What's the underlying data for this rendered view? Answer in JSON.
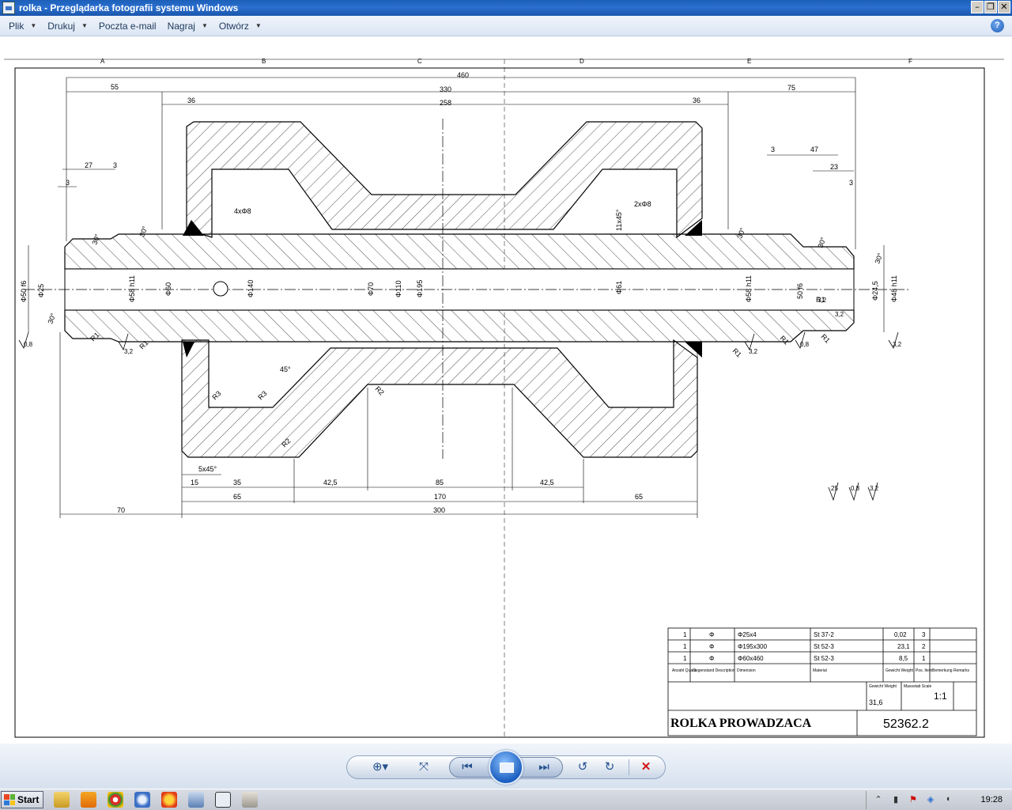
{
  "window": {
    "title": "rolka - Przeglądarka fotografii systemu Windows"
  },
  "menu": [
    {
      "label": "Plik"
    },
    {
      "label": "Drukuj"
    },
    {
      "label": "Poczta e-mail"
    },
    {
      "label": "Nagraj"
    },
    {
      "label": "Otwórz"
    }
  ],
  "drawing": {
    "zone_letters": [
      "A",
      "B",
      "C",
      "D",
      "E",
      "F"
    ],
    "dims_top": [
      "460",
      "55",
      "330",
      "75",
      "36",
      "258",
      "36",
      "27",
      "3",
      "3",
      "3",
      "47",
      "23",
      "3"
    ],
    "dims_bottom": [
      "5x45°",
      "15",
      "35",
      "42,5",
      "85",
      "42,5",
      "65",
      "170",
      "65",
      "70",
      "300"
    ],
    "diameters": [
      "Φ50 f6",
      "Φ25",
      "Φ58 h11",
      "Φ60",
      "Φ140",
      "Φ70",
      "Φ110",
      "Φ195",
      "Φ61",
      "Φ58 h11",
      "50 f6",
      "Φ24,5",
      "Φ48 h11"
    ],
    "notes": [
      "4xΦ8",
      "2xΦ8",
      "11x45°",
      "45°",
      "30°",
      "30°",
      "30°",
      "30°",
      "30°",
      "30°"
    ],
    "radii": [
      "R1",
      "R1",
      "R1",
      "R1",
      "R1",
      "R1",
      "R3",
      "R3",
      "R2",
      "R2"
    ],
    "roughness": [
      "0,8",
      "3,2",
      "3,2",
      "0,8",
      "3,2",
      "3,2",
      "3,2"
    ],
    "roughness_legend": [
      "25",
      "0,8",
      "3,2"
    ],
    "bom_rows": [
      [
        "1",
        "Φ",
        "Φ25x4",
        "St 37-2",
        "0,02",
        "3"
      ],
      [
        "1",
        "Φ",
        "Φ195x300",
        "St 52-3",
        "23,1",
        "2"
      ],
      [
        "1",
        "Φ",
        "Φ60x460",
        "St 52-3",
        "8,5",
        "1"
      ]
    ],
    "bom_headers": [
      "Anzahl Quant.",
      "Gegenstand Description",
      "Dimension",
      "Material",
      "Gewicht Weight",
      "Pos. Item",
      "Bemerkung Remarks"
    ],
    "weight_label": "Gewicht Weight",
    "weight": "31,6",
    "scale_label": "Massstab Scale",
    "scale": "1:1",
    "part_name": "ROLKA PROWADZACA",
    "part_number": "52362.2"
  },
  "taskbar": {
    "start_label": "Start",
    "clock": "19:28"
  }
}
